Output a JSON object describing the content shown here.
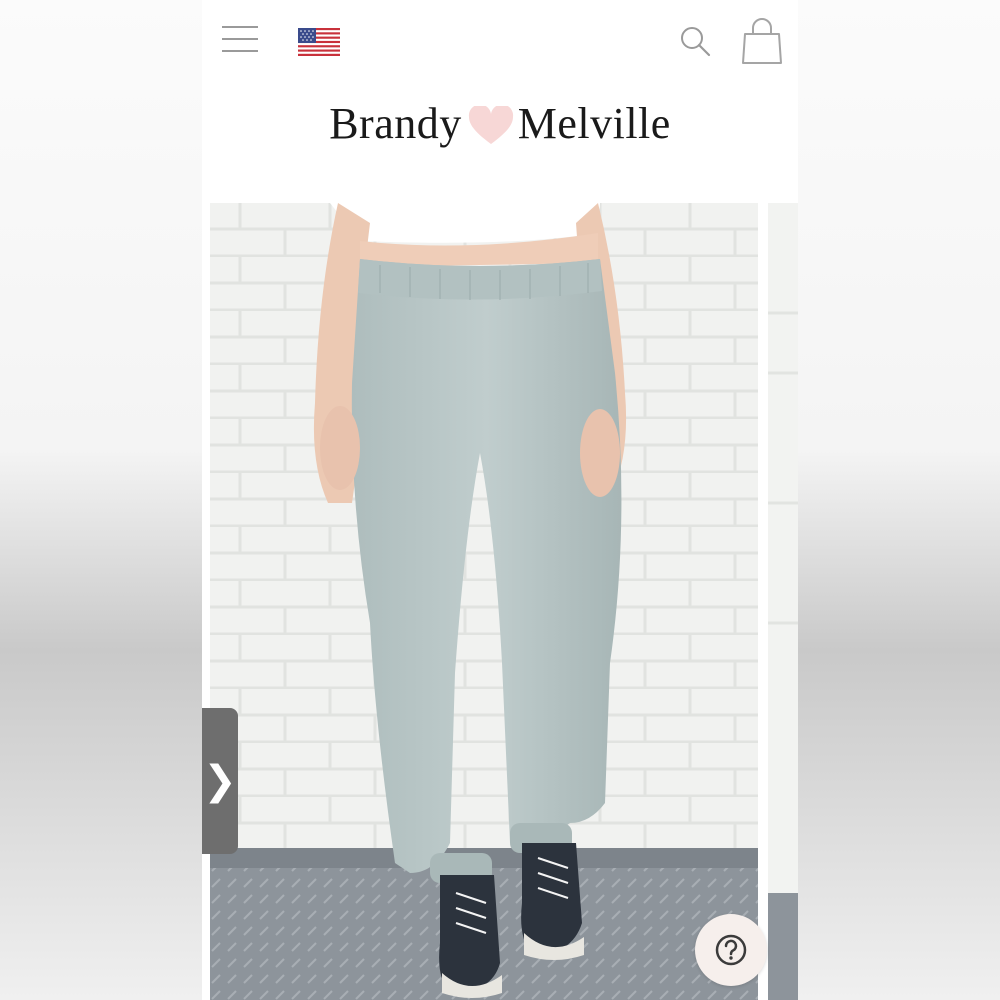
{
  "header": {
    "menu_icon": "hamburger-menu-icon",
    "flag_icon": "us-flag-icon",
    "search_icon": "search-icon",
    "bag_icon": "shopping-bag-icon"
  },
  "logo": {
    "left": "Brandy",
    "right": "Melville",
    "heart_color": "#f7d7d6"
  },
  "gallery": {
    "next_label": "❯",
    "help_icon": "question-mark-icon"
  },
  "colors": {
    "pants": "#b8c6c6",
    "wall": "#eff0ee",
    "floor": "#8c939a"
  }
}
